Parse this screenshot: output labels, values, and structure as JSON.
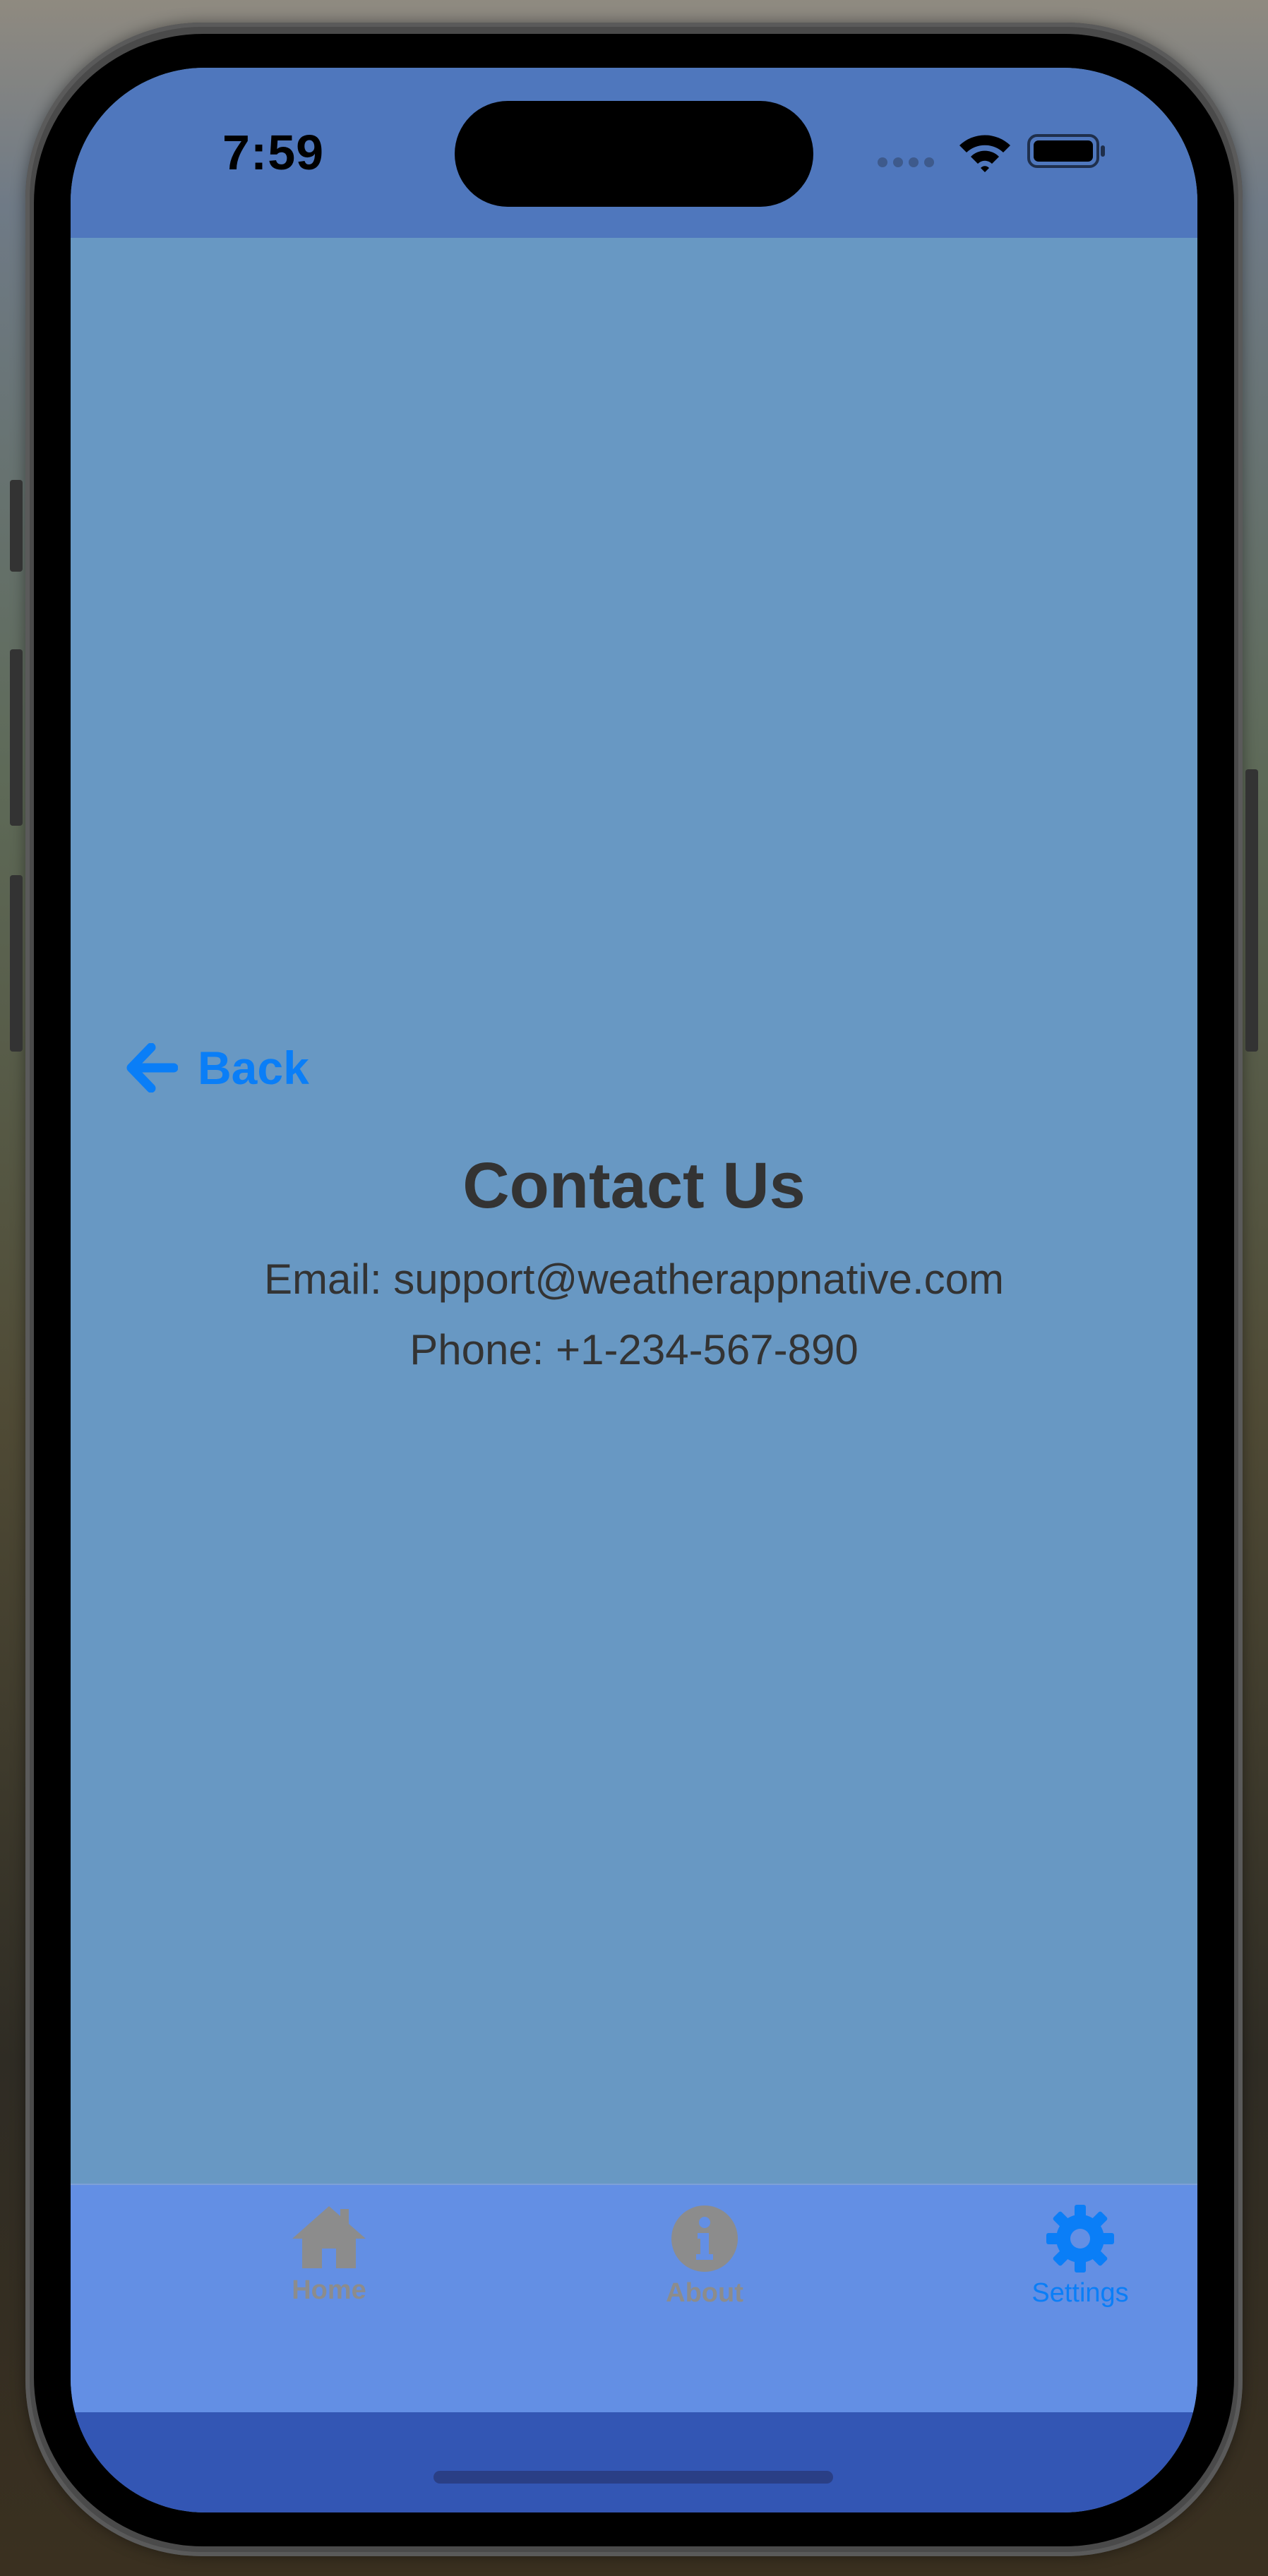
{
  "status_bar": {
    "time": "7:59"
  },
  "nav": {
    "back_label": "Back"
  },
  "contact": {
    "title": "Contact Us",
    "email_line": "Email: support@weatherappnative.com",
    "phone_line": "Phone: +1-234-567-890"
  },
  "tabs": [
    {
      "label": "Home",
      "icon": "home-icon",
      "active": false
    },
    {
      "label": "About",
      "icon": "info-icon",
      "active": false
    },
    {
      "label": "Settings",
      "icon": "gear-icon",
      "active": true
    }
  ],
  "colors": {
    "status_bar_bg": "#4f77bd",
    "content_bg": "#6898c3",
    "tabbar_bg": "#638fe4",
    "accent": "#0a7ef7",
    "inactive_tab": "#8c8c8c",
    "text": "#333333"
  }
}
